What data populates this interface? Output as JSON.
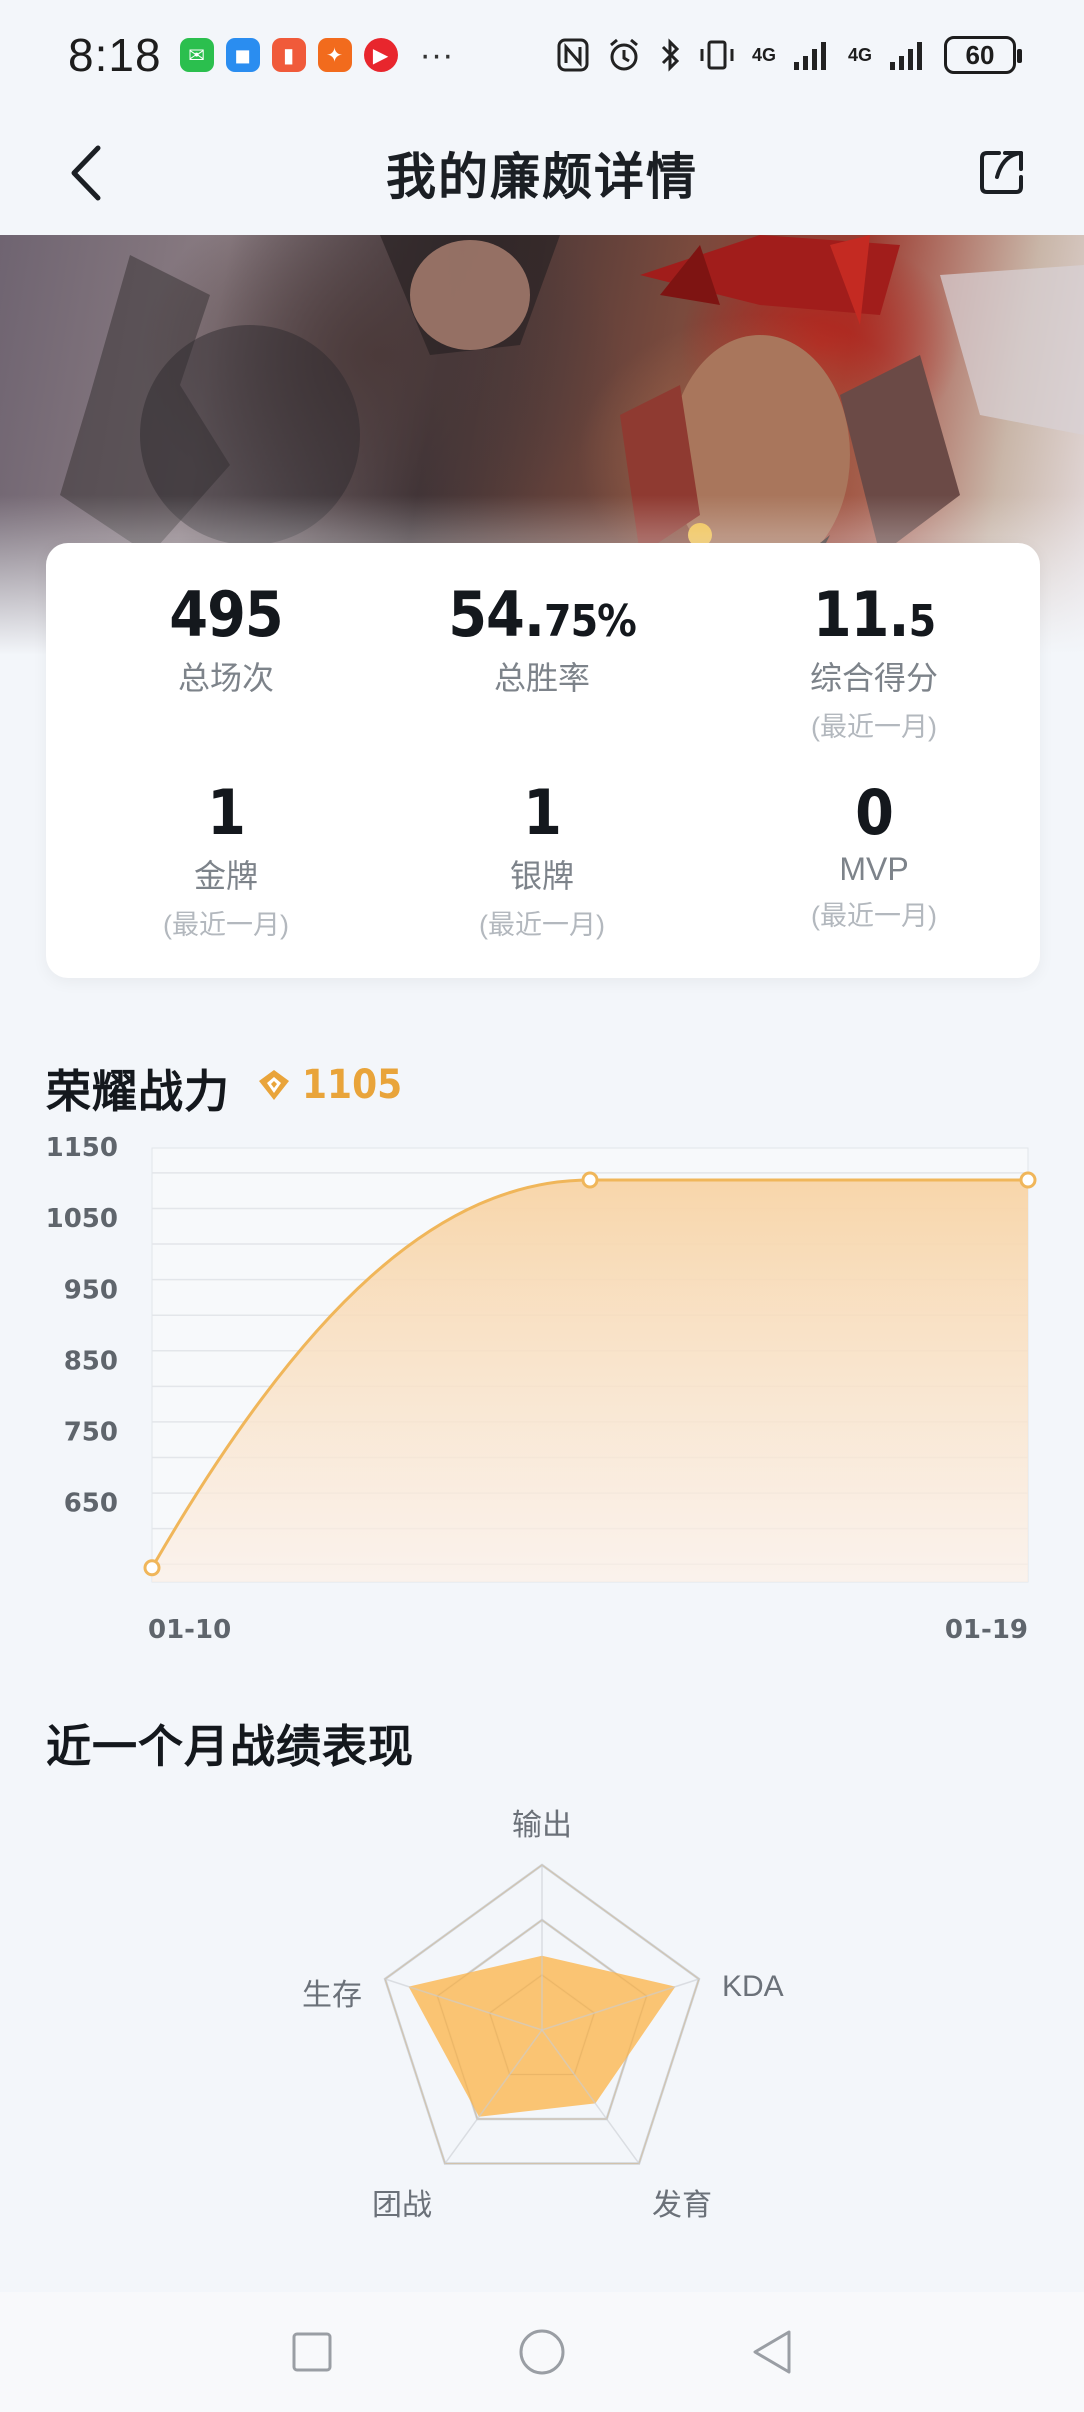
{
  "status_bar": {
    "time": "8:18",
    "more": "···",
    "network1": "4G",
    "network2": "4G",
    "battery": "60"
  },
  "header": {
    "title": "我的廉颇详情"
  },
  "stats": [
    {
      "value_main": "495",
      "value_small": "",
      "label": "总场次",
      "sub": ""
    },
    {
      "value_main": "54.",
      "value_small": "75%",
      "label": "总胜率",
      "sub": ""
    },
    {
      "value_main": "11.",
      "value_small": "5",
      "label": "综合得分",
      "sub": "(最近一月)"
    },
    {
      "value_main": "1",
      "value_small": "",
      "label": "金牌",
      "sub": "(最近一月)"
    },
    {
      "value_main": "1",
      "value_small": "",
      "label": "银牌",
      "sub": "(最近一月)"
    },
    {
      "value_main": "0",
      "value_small": "",
      "label": "MVP",
      "sub": "(最近一月)"
    }
  ],
  "power_section": {
    "title": "荣耀战力",
    "value": "1105",
    "accent_color": "#e9a43a"
  },
  "chart_data": {
    "type": "area",
    "x": [
      "01-10",
      "2024-01-15",
      "01-19"
    ],
    "x_tick_labels": [
      "01-10",
      "01-19"
    ],
    "values": [
      560,
      1105,
      1105
    ],
    "y_ticks": [
      1150,
      1050,
      950,
      850,
      750,
      650
    ],
    "ylim": [
      540,
      1150
    ],
    "title": "",
    "xlabel": "",
    "ylabel": "",
    "grid": true,
    "line_color": "#f0b65a",
    "fill_color": "#f8d4a6"
  },
  "performance_section": {
    "title": "近一个月战绩表现",
    "radar": {
      "type": "radar",
      "axes": [
        "输出",
        "KDA",
        "发育",
        "团战",
        "生存"
      ],
      "values": [
        0.45,
        0.85,
        0.55,
        0.65,
        0.85
      ],
      "fill_color": "#fbbf67"
    }
  },
  "nav": {
    "icons": [
      "recent-apps-icon",
      "home-icon",
      "back-icon"
    ]
  }
}
